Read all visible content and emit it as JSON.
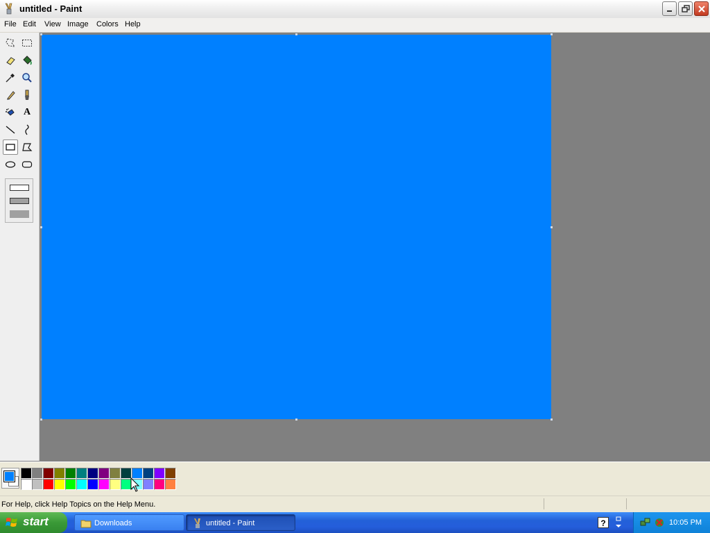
{
  "window": {
    "title": "untitled - Paint",
    "controls": [
      "minimize",
      "restore",
      "close"
    ]
  },
  "menu": [
    "File",
    "Edit",
    "View",
    "Image",
    "Colors",
    "Help"
  ],
  "toolbox": {
    "tools": [
      "free-form-select",
      "select",
      "eraser",
      "fill-with-color",
      "pick-color",
      "magnifier",
      "pencil",
      "brush",
      "airbrush",
      "text",
      "line",
      "curve",
      "rectangle",
      "polygon",
      "ellipse",
      "rounded-rectangle"
    ],
    "selected_tool": "rectangle",
    "fill_styles": [
      "outline",
      "outline-with-fill",
      "fill-only"
    ],
    "text_tool_glyph": "A"
  },
  "canvas": {
    "fill_color": "#0080ff"
  },
  "palette": {
    "foreground": "#0080ff",
    "background": "#ffffff",
    "row1": [
      "#000000",
      "#808080",
      "#800000",
      "#808000",
      "#008000",
      "#008080",
      "#000080",
      "#800080",
      "#808040",
      "#004040",
      "#0080ff",
      "#004080",
      "#8000ff",
      "#804000"
    ],
    "row2": [
      "#ffffff",
      "#c0c0c0",
      "#ff0000",
      "#ffff00",
      "#00ff00",
      "#00ffff",
      "#0000ff",
      "#ff00ff",
      "#ffff80",
      "#00ff80",
      "#80ffff",
      "#8080ff",
      "#ff0080",
      "#ff8040"
    ]
  },
  "status": {
    "text": "For Help, click Help Topics on the Help Menu."
  },
  "taskbar": {
    "start_label": "start",
    "tasks": [
      {
        "label": "Downloads",
        "icon": "folder-icon",
        "active": false
      },
      {
        "label": "untitled - Paint",
        "icon": "paint-icon",
        "active": true
      }
    ],
    "clock": "10:05 PM",
    "help_glyph": "?"
  }
}
